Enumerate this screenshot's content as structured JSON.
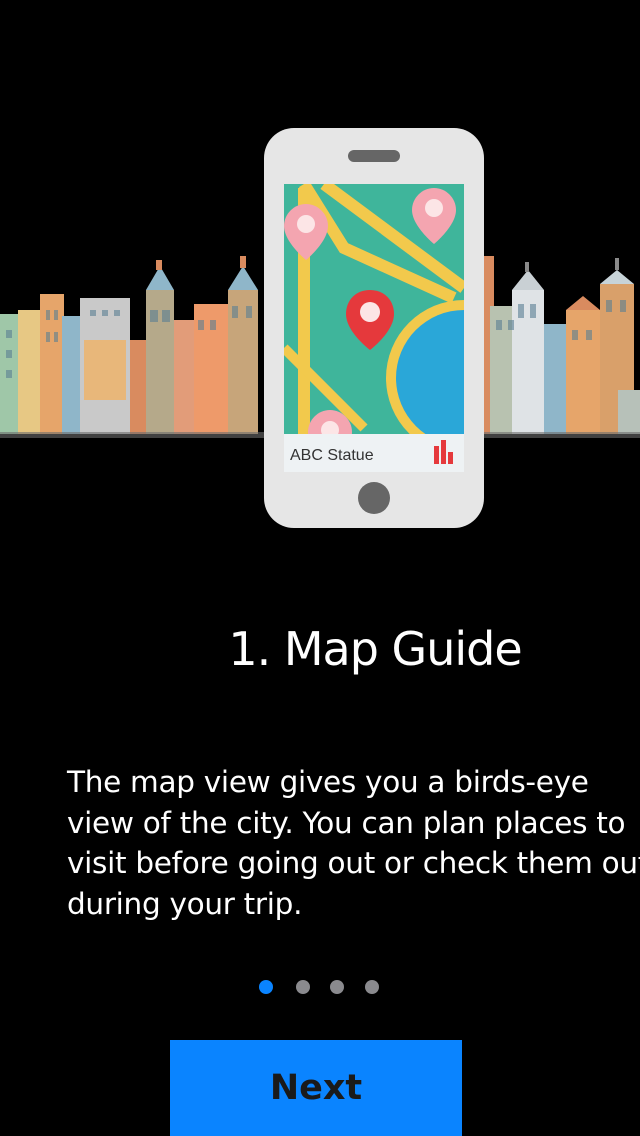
{
  "hero": {
    "phone_screen_label": "ABC Statue"
  },
  "page": {
    "title": "1. Map Guide",
    "description_lines": [
      "The map view gives you a birds-eye",
      "view of the city. You can plan places to",
      "visit before going out or check them out",
      "during your trip."
    ]
  },
  "pagination": {
    "total": 4,
    "current": 1
  },
  "buttons": {
    "next_label": "Next"
  },
  "colors": {
    "accent": "#0a84ff",
    "inactive_dot": "#8a8a8e",
    "background": "#000000",
    "map_water_green": "#3fb59b",
    "map_road_yellow": "#f2c94c",
    "map_lake_blue": "#2aa7d8",
    "pin_red": "#e5393c",
    "pin_pink": "#f4a5b0"
  }
}
